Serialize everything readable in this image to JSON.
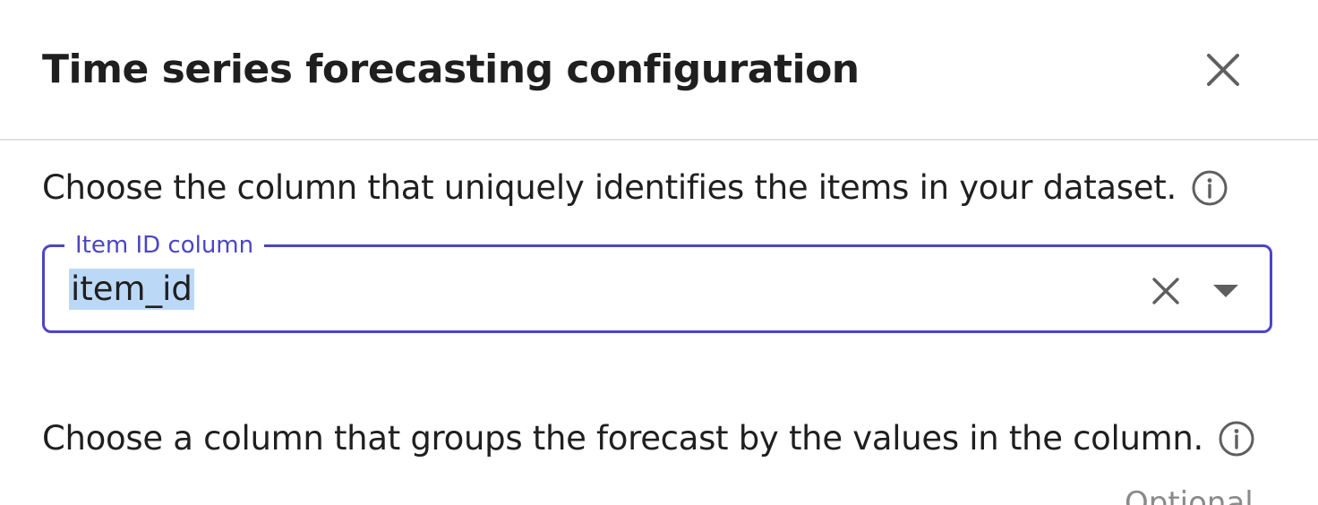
{
  "dialog": {
    "title": "Time series forecasting configuration",
    "close_icon": "close-icon"
  },
  "item_id_section": {
    "description": "Choose the column that uniquely identifies the items in your dataset.",
    "info_icon": "info-icon",
    "field": {
      "label": "Item ID column",
      "value": "item_id",
      "clear_icon": "clear-icon",
      "dropdown_icon": "caret-down-icon"
    }
  },
  "group_section": {
    "description": "Choose a column that groups the forecast by the values in the column.",
    "info_icon": "info-icon",
    "optional_label": "Optional"
  },
  "colors": {
    "accent": "#4b45c6",
    "selection": "#bcd8f7",
    "text": "#1f1f1f",
    "muted": "#8a8a8a"
  }
}
